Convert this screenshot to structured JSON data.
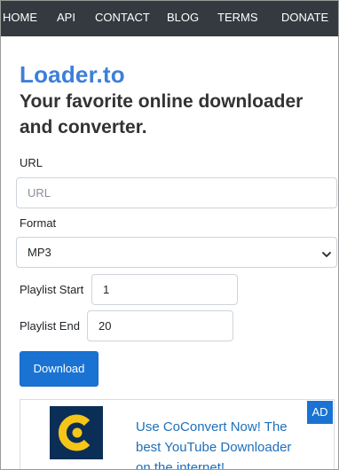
{
  "nav": {
    "items": [
      {
        "label": "HOME"
      },
      {
        "label": "API"
      },
      {
        "label": "CONTACT"
      },
      {
        "label": "BLOG"
      },
      {
        "label": "TERMS"
      },
      {
        "label": "DONATE"
      }
    ]
  },
  "header": {
    "brand": "Loader.to",
    "tagline": "Your favorite online downloader and converter."
  },
  "form": {
    "url_label": "URL",
    "url_placeholder": "URL",
    "url_value": "",
    "format_label": "Format",
    "format_selected": "MP3",
    "playlist_start_label": "Playlist Start",
    "playlist_start_value": "1",
    "playlist_end_label": "Playlist End",
    "playlist_end_value": "20",
    "download_label": "Download"
  },
  "ad": {
    "badge": "AD",
    "logo_icon": "coconvert-logo-icon",
    "text": "Use CoConvert Now! The best YouTube Downloader on the internet!"
  },
  "colors": {
    "nav_bg": "#343a40",
    "brand": "#3d7fd9",
    "button": "#1a73d2",
    "ad_text": "#1f6fb8",
    "logo_bg": "#0b2e57",
    "logo_yellow": "#f5c518"
  }
}
